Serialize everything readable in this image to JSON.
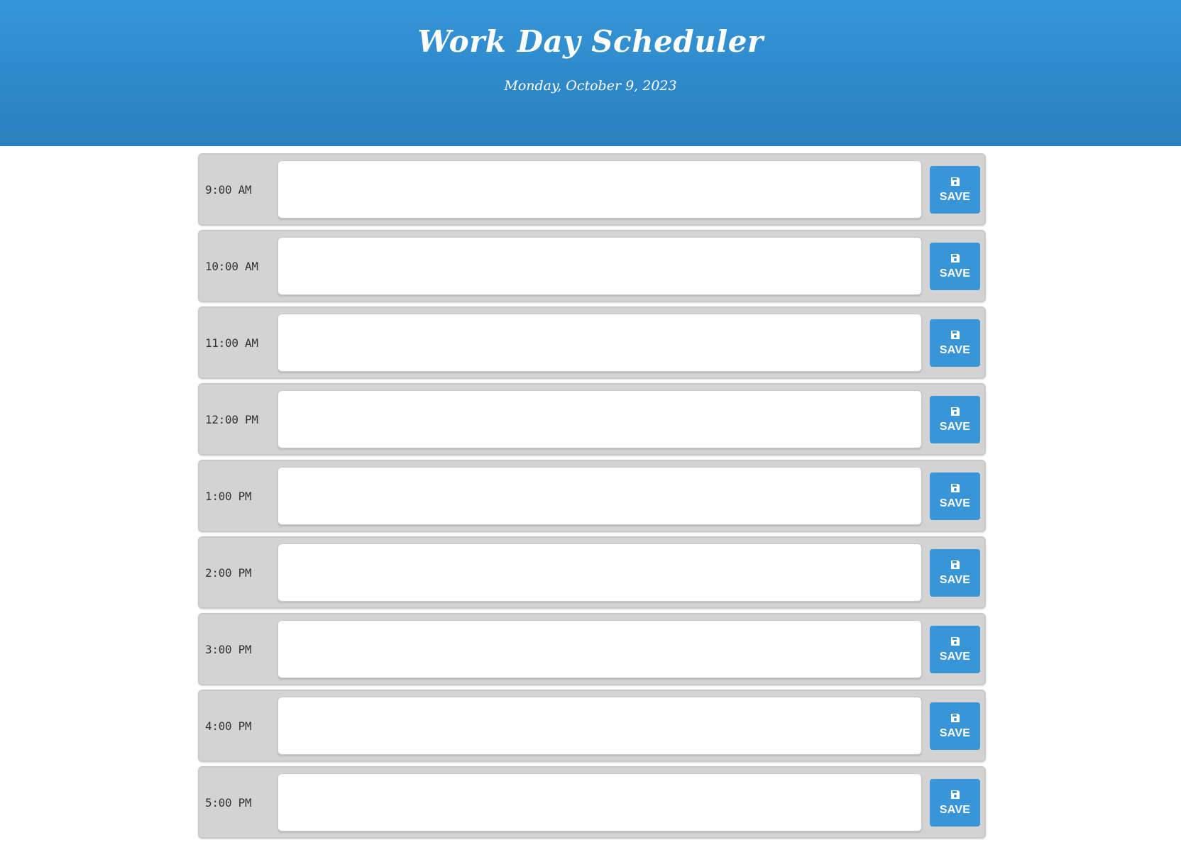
{
  "header": {
    "title": "Work Day Scheduler",
    "date": "Monday, October 9, 2023"
  },
  "colors": {
    "header_bg": "#3496d9",
    "save_button": "#3795d8",
    "block_bg": "#d3d3d3"
  },
  "time_blocks": [
    {
      "hour": "9:00 AM",
      "text": "",
      "button_label": "SAVE",
      "icon": "save-icon"
    },
    {
      "hour": "10:00 AM",
      "text": "",
      "button_label": "SAVE",
      "icon": "save-icon"
    },
    {
      "hour": "11:00 AM",
      "text": "",
      "button_label": "SAVE",
      "icon": "save-icon"
    },
    {
      "hour": "12:00 PM",
      "text": "",
      "button_label": "SAVE",
      "icon": "save-icon"
    },
    {
      "hour": "1:00 PM",
      "text": "",
      "button_label": "SAVE",
      "icon": "save-icon"
    },
    {
      "hour": "2:00 PM",
      "text": "",
      "button_label": "SAVE",
      "icon": "save-icon"
    },
    {
      "hour": "3:00 PM",
      "text": "",
      "button_label": "SAVE",
      "icon": "save-icon"
    },
    {
      "hour": "4:00 PM",
      "text": "",
      "button_label": "SAVE",
      "icon": "save-icon"
    },
    {
      "hour": "5:00 PM",
      "text": "",
      "button_label": "SAVE",
      "icon": "save-icon"
    }
  ]
}
